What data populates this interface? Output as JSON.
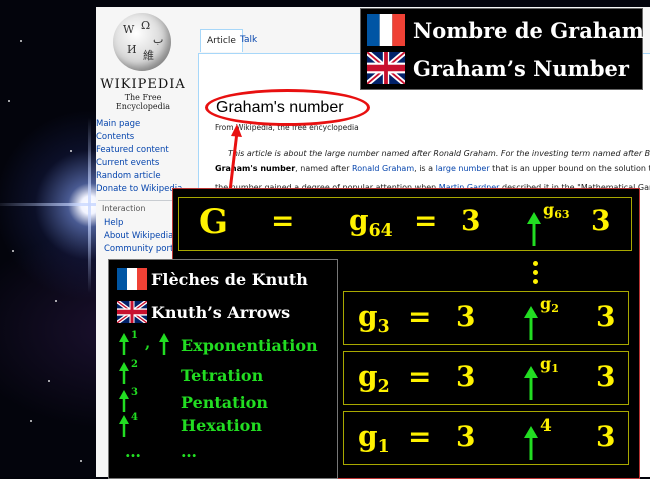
{
  "wiki": {
    "wordmark": "WIKIPEDIA",
    "tagline": "The Free Encyclopedia",
    "tabs": [
      "Article",
      "Talk"
    ],
    "sidebar_links": [
      "Main page",
      "Contents",
      "Featured content",
      "Current events",
      "Random article",
      "Donate to Wikipedia"
    ],
    "interaction_heading": "Interaction",
    "interaction_links": [
      "Help",
      "About Wikipedia",
      "Community portal"
    ],
    "title": "Graham's number",
    "subtitle": "From Wikipedia, the free encyclopedia",
    "hatnote": "This article is about the large number named after Ronald Graham. For the investing term named after B",
    "para1_bold": "Graham's number",
    "para1_a": ", named after ",
    "para1_link1": "Ronald Graham",
    "para1_b": ", is a ",
    "para1_link2": "large number",
    "para1_c": " that is an upper bound on the solution to",
    "para2_a": "the number gained a degree of popular attention when ",
    "para2_link": "Martin Gardner",
    "para2_b": " described it in the \"Mathematical Gam"
  },
  "languages": {
    "french_title": "Nombre de Graham",
    "english_title": "Graham’s Number",
    "french_flag_icon": "france-flag-icon",
    "english_flag_icon": "uk-flag-icon"
  },
  "formula": {
    "G": "G",
    "equals": "=",
    "base": "3",
    "rows": [
      {
        "name": "g",
        "index": "64",
        "arrow_exp": "g63"
      },
      {
        "name": "g",
        "index": "3",
        "arrow_exp": "g2"
      },
      {
        "name": "g",
        "index": "2",
        "arrow_exp": "g1"
      },
      {
        "name": "g",
        "index": "1",
        "arrow_exp": "4"
      }
    ],
    "arrow_icon": "up-arrow-icon",
    "vertical_ellipsis_icon": "vertical-ellipsis-icon"
  },
  "knuth": {
    "french_title": "Flèches de Knuth",
    "english_title": "Knuth’s Arrows",
    "operations": [
      {
        "arrows": "1",
        "alt": ", ",
        "name": "Exponentiation"
      },
      {
        "arrows": "2",
        "name": "Tetration"
      },
      {
        "arrows": "3",
        "name": "Pentation"
      },
      {
        "arrows": "4",
        "name": "Hexation"
      }
    ],
    "ellipsis_left": "…",
    "ellipsis_right": "…"
  },
  "colors": {
    "formula_yellow": "#fff200",
    "knuth_green": "#22dd22",
    "highlight_red": "#e81010"
  }
}
